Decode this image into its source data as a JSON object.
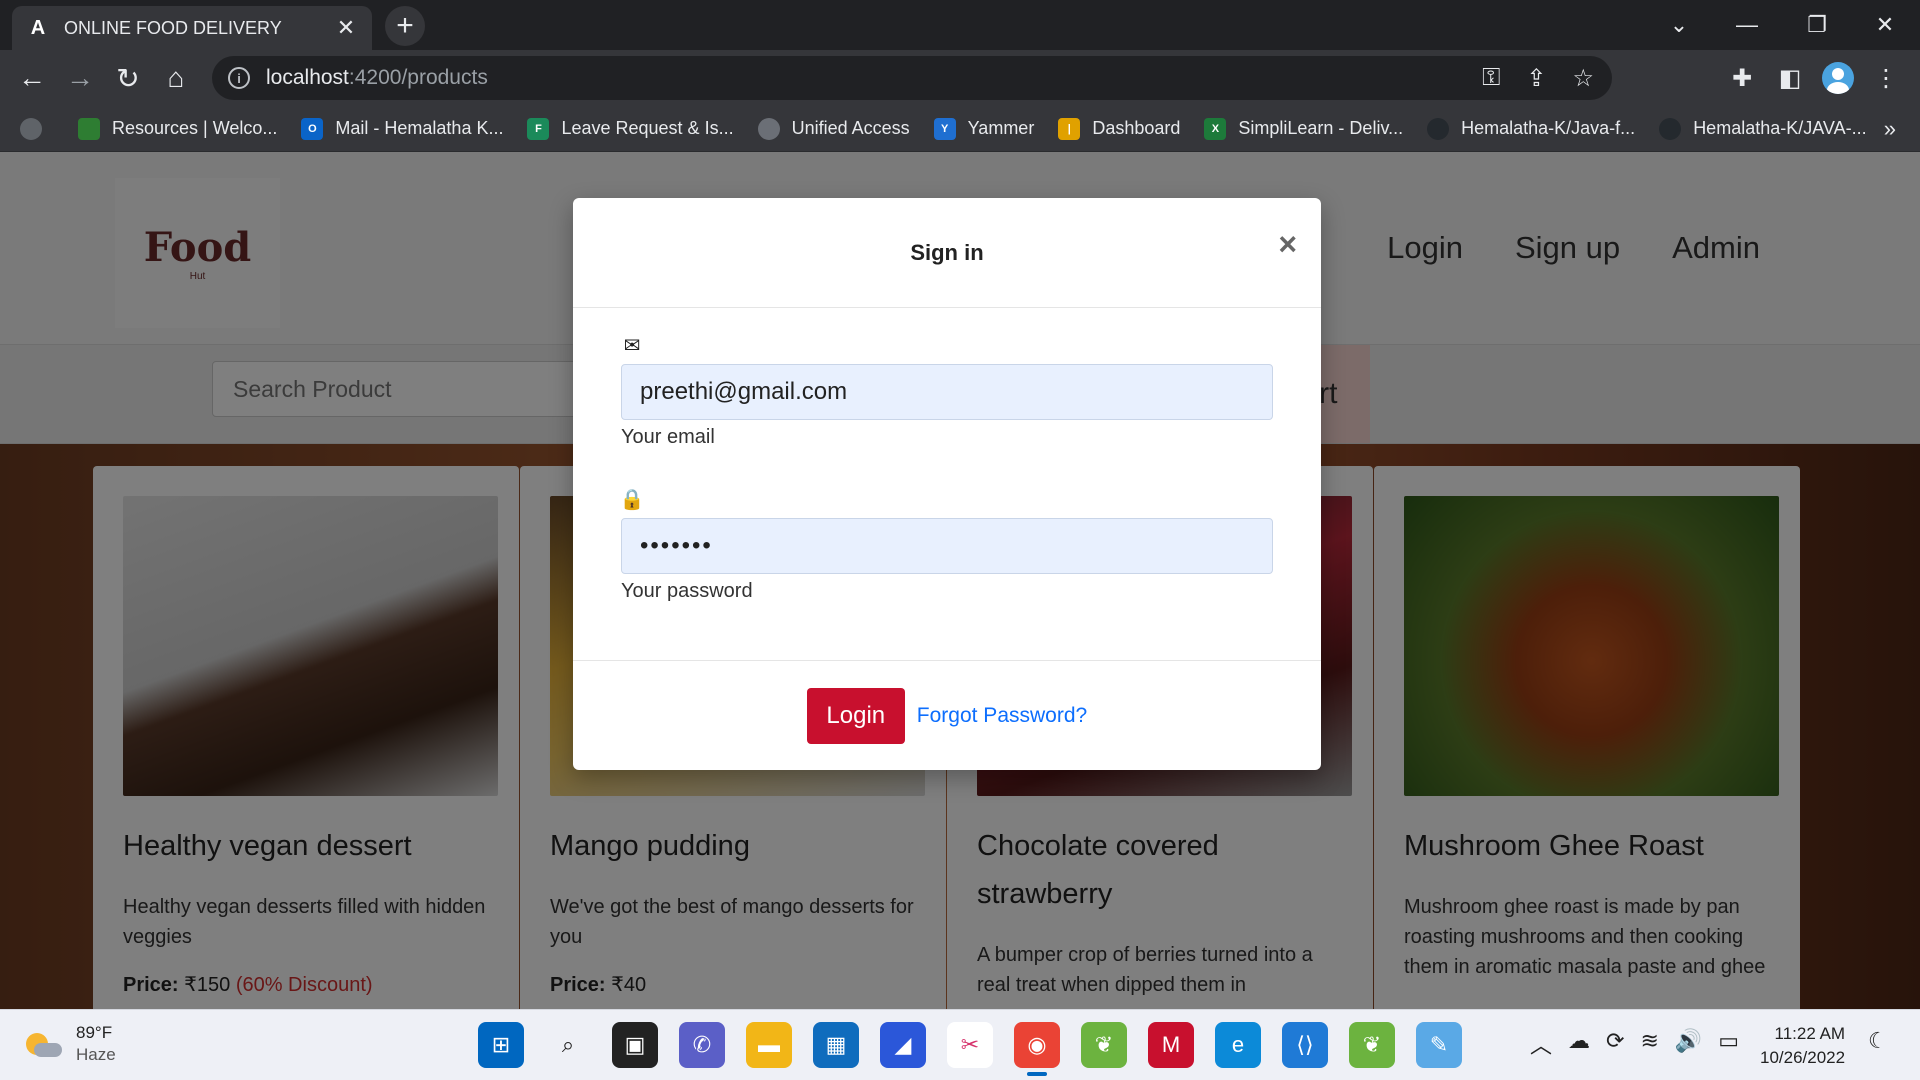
{
  "browser": {
    "tab_title": "ONLINE FOOD DELIVERY",
    "tab_favicon": "A",
    "url_host": "localhost",
    "url_path": ":4200/products",
    "bookmarks": [
      {
        "label": "Resources | Welco...",
        "color": "#2e7d32"
      },
      {
        "label": "Mail - Hemalatha K...",
        "color": "#0a64c8"
      },
      {
        "label": "Leave Request & Is...",
        "color": "#1b8a5a"
      },
      {
        "label": "Unified Access",
        "color": "#6b6f76"
      },
      {
        "label": "Yammer",
        "color": "#1f6fd1"
      },
      {
        "label": "Dashboard",
        "color": "#e0a100"
      },
      {
        "label": "SimpliLearn - Deliv...",
        "color": "#1d7a3a"
      },
      {
        "label": "Hemalatha-K/Java-f...",
        "color": "#24292e"
      },
      {
        "label": "Hemalatha-K/JAVA-...",
        "color": "#24292e"
      }
    ]
  },
  "site": {
    "logo_text": "Food",
    "logo_sub": "Hut",
    "nav": [
      "Login",
      "Sign up",
      "Admin"
    ],
    "search_placeholder": "Search Product",
    "category_button": "ert"
  },
  "products": [
    {
      "title": "Healthy vegan dessert",
      "desc": "Healthy vegan desserts filled with hidden veggies",
      "price_label": "Price:",
      "price": "₹150",
      "discount": "(60% Discount)"
    },
    {
      "title": "Mango pudding",
      "desc": "We've got the best of mango desserts for you",
      "price_label": "Price:",
      "price": "₹40",
      "discount": ""
    },
    {
      "title": "Chocolate covered strawberry",
      "desc": "A bumper crop of berries turned into a real treat when dipped them in",
      "price_label": "",
      "price": "",
      "discount": ""
    },
    {
      "title": "Mushroom Ghee Roast",
      "desc": "Mushroom ghee roast is made by pan roasting mushrooms and then cooking them in aromatic masala paste and ghee",
      "price_label": "",
      "price": "",
      "discount": ""
    }
  ],
  "modal": {
    "title": "Sign in",
    "close_glyph": "×",
    "email_value": "preethi@gmail.com",
    "email_help": "Your email",
    "password_value": "•••••••",
    "password_help": "Your password",
    "login_label": "Login",
    "forgot_label": "Forgot Password?"
  },
  "taskbar": {
    "temperature": "89°F",
    "weather": "Haze",
    "time": "11:22 AM",
    "date": "10/26/2022"
  }
}
